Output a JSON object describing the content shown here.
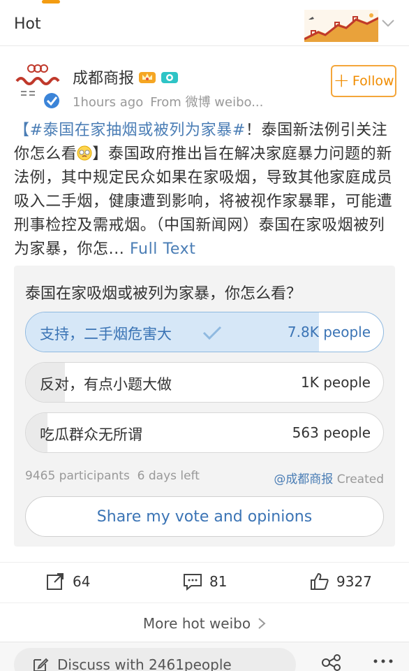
{
  "topbar": {
    "tab_label": "Hot"
  },
  "post": {
    "author": "成都商报",
    "time": "1hours ago",
    "source": "From 微博 weibo...",
    "follow_label": "Follow",
    "text_tag": "【#泰国在家抽烟或被列为家暴#",
    "text_part1": "！泰国新法例引关注 你怎么看",
    "text_part2": "】泰国政府推出旨在解决家庭暴力问题的新法例，其中规定民众如果在家吸烟，导致其他家庭成员吸入二手烟，健康遭到影响，将被视作家暴罪，可能遭刑事检控及需戒烟。（中国新闻网）泰国在家吸烟被列为家暴，你怎...",
    "full_text_label": "Full Text"
  },
  "poll": {
    "question": "泰国在家吸烟或被列为家暴，你怎么看？",
    "options": [
      {
        "label": "支持，二手烟危害大",
        "count": "7.8K people",
        "share": 0.82,
        "selected": true
      },
      {
        "label": "反对，有点小题大做",
        "count": "1K people",
        "share": 0.11,
        "selected": false
      },
      {
        "label": "吃瓜群众无所谓",
        "count": "563 people",
        "share": 0.06,
        "selected": false
      }
    ],
    "participants": "9465 participants",
    "days_left": "6 days left",
    "creator_handle": "@成都商报",
    "creator_suffix": "Created",
    "share_label": "Share my vote and opinions"
  },
  "actions": {
    "reposts": "64",
    "comments": "81",
    "likes": "9327"
  },
  "more_hot_label": "More hot weibo",
  "bottombar": {
    "discuss_label": "Discuss with 2461people"
  },
  "colors": {
    "accent": "#f08c00",
    "link": "#4a7db5",
    "selected_fill": "#d6e7f7"
  }
}
